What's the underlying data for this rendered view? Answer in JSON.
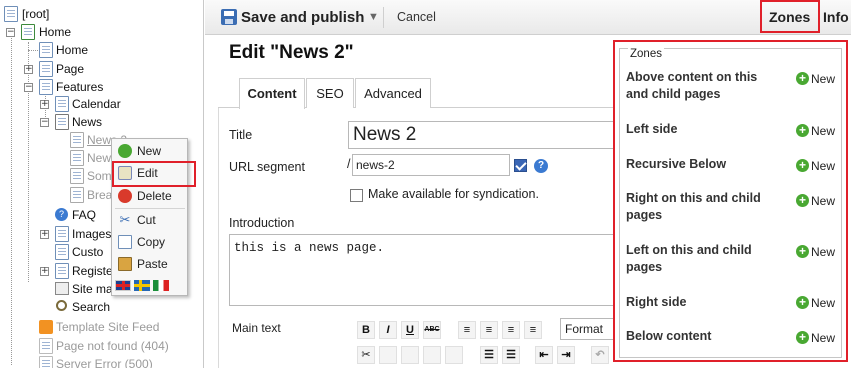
{
  "tree": {
    "root": "[root]",
    "home": "Home",
    "home_child": "Home",
    "page": "Page",
    "features": "Features",
    "calendar": "Calendar",
    "news": "News",
    "news2": "News 2",
    "news_other": "New",
    "some": "Som",
    "bread": "Brea",
    "faq": "FAQ",
    "images": "Images",
    "custom": "Custo",
    "register": "Registe",
    "sitemap": "Site ma",
    "search": "Search",
    "template_feed": "Template Site Feed",
    "page_not_found": "Page not found (404)",
    "server_error": "Server Error (500)"
  },
  "context_menu": {
    "new": "New",
    "edit": "Edit",
    "delete": "Delete",
    "cut": "Cut",
    "copy": "Copy",
    "paste": "Paste",
    "flags": [
      "uk-flag",
      "se-flag",
      "it-flag"
    ]
  },
  "toolbar": {
    "save": "Save and publish",
    "cancel": "Cancel",
    "zones": "Zones",
    "info": "Info"
  },
  "editor": {
    "title": "Edit \"News 2\"",
    "tabs": [
      "Content",
      "SEO",
      "Advanced"
    ],
    "title_label": "Title",
    "title_value": "News 2",
    "url_label": "URL segment",
    "url_prefix": "/",
    "url_value": "news-2",
    "syndication_label": "Make available for syndication.",
    "intro_label": "Introduction",
    "intro_value": "this is a news page.",
    "main_text_label": "Main text",
    "format_value": "Format",
    "rte_buttons": [
      "B",
      "I",
      "U",
      "ABC"
    ]
  },
  "zones": {
    "legend": "Zones",
    "new_label": "New",
    "items": [
      "Above content on this and child pages",
      "Left side",
      "Recursive Below",
      "Right on this and child pages",
      "Left on this and child pages",
      "Right side",
      "Below content"
    ]
  },
  "colors": {
    "accent": "#e0202a",
    "new_green": "#49a832",
    "link_blue": "#3b6db3"
  }
}
